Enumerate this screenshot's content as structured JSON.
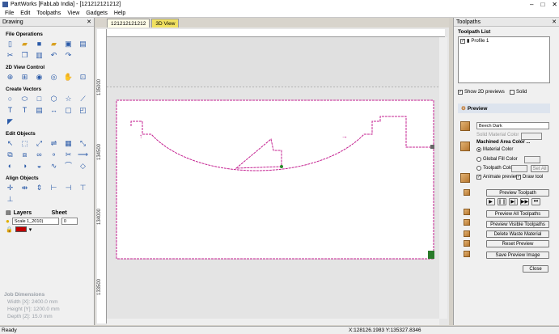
{
  "app": {
    "title": "PartWorks [FabLab India] - [121212121212]",
    "logo_text": "PW"
  },
  "window_controls": {
    "minimize": "–",
    "maximize": "□",
    "close": "✕"
  },
  "menu": [
    "File",
    "Edit",
    "Toolpaths",
    "View",
    "Gadgets",
    "Help"
  ],
  "left_panel": {
    "title": "Drawing",
    "sections": {
      "file_ops": "File Operations",
      "view_control": "2D View Control",
      "create_vectors": "Create Vectors",
      "edit_objects": "Edit Objects",
      "align_objects": "Align Objects"
    },
    "layers_label": "Layers",
    "sheet_label": "Sheet",
    "layer_value": "Scale 1_2010)",
    "sheet_value": "0",
    "job_dimensions": {
      "title": "Job Dimensions",
      "width": "Width  [X]: 2400.0 mm",
      "height": "Height [Y]: 1200.0 mm",
      "depth": "Depth  [Z]: 15.0 mm"
    }
  },
  "tabs": [
    {
      "label": "121212121212"
    },
    {
      "label": "3D View"
    }
  ],
  "rulers": {
    "v1": "135000",
    "v2": "134500",
    "v3": "134000",
    "v4": "133500"
  },
  "right_panel": {
    "title": "Toolpaths",
    "list_title": "Toolpath List",
    "item": "Profile 1",
    "show_previews": "Show 2D previews",
    "solid": "Solid",
    "preview_title": "Preview",
    "material": "Beech Dark",
    "solid_material_color": "Solid Material Color",
    "machined_area": "Machined Area Color ...",
    "material_color": "Material Color",
    "global_fill": "Global Fill Color",
    "toolpath_color": "Toolpath Color",
    "set_all": "Set All",
    "animate": "Animate preview",
    "draw_tool": "Draw tool",
    "preview_toolpath": "Preview Toolpath",
    "preview_all": "Preview All Toolpaths",
    "preview_visible": "Preview Visible Toolpaths",
    "delete_waste": "Delete Waste Material",
    "reset_preview": "Reset Preview",
    "save_preview": "Save Preview Image",
    "close": "Close"
  },
  "status": {
    "left": "Ready",
    "coords": "X:128126.1983 Y:135327.8346"
  }
}
